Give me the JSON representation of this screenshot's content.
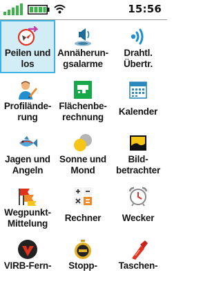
{
  "status": {
    "time": "15:56",
    "battery_color": "#3bb54a",
    "signal_color": "#3bb54a"
  },
  "apps": [
    {
      "label": "Peilen und\nlos",
      "icon": "compass-arrow-icon"
    },
    {
      "label": "Annäherun-\ngsalarme",
      "icon": "proximity-alarm-icon"
    },
    {
      "label": "Drahtl.\nÜbertr.",
      "icon": "wireless-transfer-icon"
    },
    {
      "label": "Profilände-\nrung",
      "icon": "profile-change-icon"
    },
    {
      "label": "Flächenbe-\nrechnung",
      "icon": "area-calculation-icon"
    },
    {
      "label": "Kalender",
      "icon": "calendar-icon"
    },
    {
      "label": "Jagen und\nAngeln",
      "icon": "fish-icon"
    },
    {
      "label": "Sonne und\nMond",
      "icon": "sun-moon-icon"
    },
    {
      "label": "Bild-\nbetrachter",
      "icon": "image-viewer-icon"
    },
    {
      "label": "Wegpunkt-\nMittelung",
      "icon": "waypoint-averaging-icon"
    },
    {
      "label": "Rechner",
      "icon": "calculator-icon"
    },
    {
      "label": "Wecker",
      "icon": "alarm-clock-icon"
    },
    {
      "label": "VIRB-Fern-",
      "icon": "virb-remote-icon"
    },
    {
      "label": "Stopp-",
      "icon": "stopwatch-icon"
    },
    {
      "label": "Taschen-",
      "icon": "flashlight-icon"
    }
  ]
}
